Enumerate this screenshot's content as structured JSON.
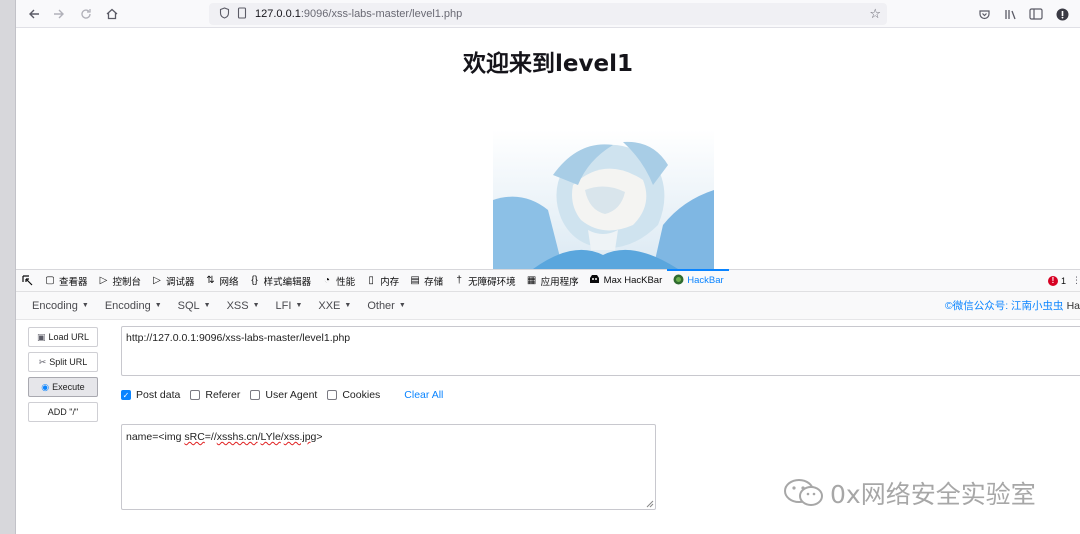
{
  "browser": {
    "address": {
      "host": "127.0.0.1",
      "path": ":9096/xss-labs-master/level1.php"
    },
    "icons": [
      "back-icon",
      "forward-icon",
      "reload-icon",
      "home-icon",
      "shield-icon",
      "page-icon",
      "bookmark-star-icon",
      "pocket-icon",
      "library-icon",
      "sidebar-icon",
      "account-icon"
    ]
  },
  "page": {
    "title": "欢迎来到level1"
  },
  "devtools": {
    "tabs": [
      {
        "label": "查看器",
        "icon": "inspector-icon"
      },
      {
        "label": "控制台",
        "icon": "console-icon"
      },
      {
        "label": "调试器",
        "icon": "debugger-icon"
      },
      {
        "label": "网络",
        "icon": "network-icon"
      },
      {
        "label": "样式编辑器",
        "icon": "style-editor-icon"
      },
      {
        "label": "性能",
        "icon": "performance-icon"
      },
      {
        "label": "内存",
        "icon": "memory-icon"
      },
      {
        "label": "存储",
        "icon": "storage-icon"
      },
      {
        "label": "无障碍环境",
        "icon": "accessibility-icon"
      },
      {
        "label": "应用程序",
        "icon": "application-icon"
      },
      {
        "label": "Max HacKBar",
        "icon": "max-hackbar-icon"
      },
      {
        "label": "HackBar",
        "icon": "hackbar-icon"
      }
    ],
    "error_count": "1"
  },
  "hackbar": {
    "menus": [
      "Encoding",
      "Encoding",
      "SQL",
      "XSS",
      "LFI",
      "XXE",
      "Other"
    ],
    "credit_link": "©微信公众号: 江南小虫虫",
    "credit_tail": "Ha",
    "buttons": {
      "load_url": "Load URL",
      "split_url": "Split URL",
      "execute": "Execute",
      "add_slash": "ADD \"/\""
    },
    "url_value": "http://127.0.0.1:9096/xss-labs-master/level1.php",
    "options": {
      "post_data": "Post data",
      "referer": "Referer",
      "user_agent": "User Agent",
      "cookies": "Cookies",
      "clear_all": "Clear All"
    },
    "post_value": {
      "prefix": "name=<img ",
      "src_attr": "sRC",
      "eq": "=//",
      "domain": "xsshs.cn",
      "slash1": "/",
      "path_part": "LYle",
      "slash2": "/",
      "file": "xss.jpg",
      "suffix": ">"
    }
  },
  "watermark": {
    "text": "0x网络安全实验室"
  },
  "colors": {
    "accent": "#0a84ff",
    "error": "#d70022"
  }
}
